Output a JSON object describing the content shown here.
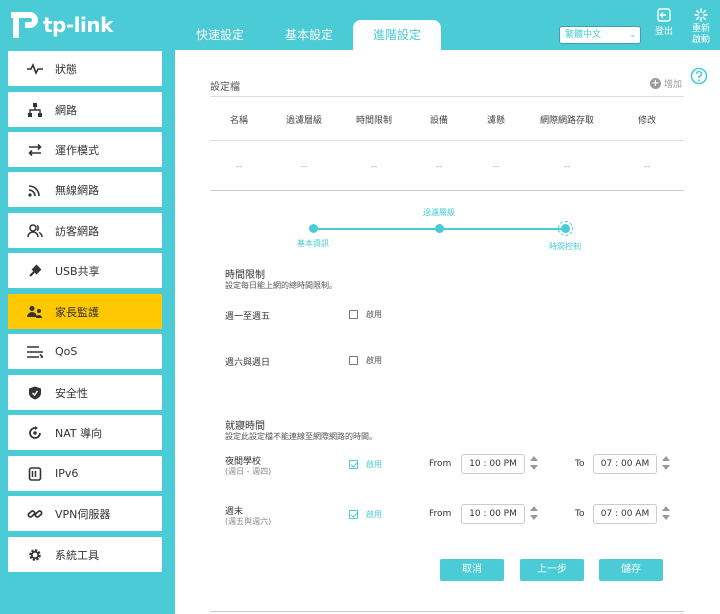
{
  "brand": {
    "logo_text": "tp-link"
  },
  "header": {
    "tabs": [
      {
        "label": "快速設定",
        "active": false
      },
      {
        "label": "基本設定",
        "active": false
      },
      {
        "label": "進階設定",
        "active": true
      }
    ],
    "language": "繁體中文",
    "logout_label": "登出",
    "reboot_label": "重新啟動"
  },
  "sidebar": {
    "items": [
      {
        "label": "狀態",
        "icon": "pulse-icon",
        "active": false
      },
      {
        "label": "網路",
        "icon": "network-icon",
        "active": false
      },
      {
        "label": "運作模式",
        "icon": "mode-icon",
        "active": false
      },
      {
        "label": "無線網路",
        "icon": "wifi-icon",
        "active": false
      },
      {
        "label": "訪客網路",
        "icon": "guest-icon",
        "active": false
      },
      {
        "label": "USB共享",
        "icon": "usb-icon",
        "active": false
      },
      {
        "label": "家長監護",
        "icon": "parental-icon",
        "active": true
      },
      {
        "label": "QoS",
        "icon": "qos-icon",
        "active": false
      },
      {
        "label": "安全性",
        "icon": "shield-icon",
        "active": false
      },
      {
        "label": "NAT 導向",
        "icon": "nat-icon",
        "active": false
      },
      {
        "label": "IPv6",
        "icon": "ipv6-icon",
        "active": false
      },
      {
        "label": "VPN伺服器",
        "icon": "vpn-icon",
        "active": false
      },
      {
        "label": "系統工具",
        "icon": "gear-icon",
        "active": false
      }
    ]
  },
  "profile": {
    "title": "設定檔",
    "add_label": "增加",
    "columns": [
      "名稱",
      "過濾層級",
      "時間限制",
      "設備",
      "濾懸",
      "網際網路存取",
      "修改"
    ],
    "row": [
      "--",
      "--",
      "--",
      "--",
      "--",
      "--",
      "--"
    ]
  },
  "stepper": {
    "steps": [
      "基本資訊",
      "過濾層級",
      "時間控制"
    ]
  },
  "time_limit": {
    "title": "時間限制",
    "desc": "設定每日能上網的總時間限制。",
    "weekday_label": "週一至週五",
    "weekend_label": "週六與週日",
    "enable_label": "啟用"
  },
  "bedtime": {
    "title": "就寢時間",
    "desc": "設定此設定檔不能連線至網際網路的時間。",
    "rows": [
      {
        "label": "夜間學校",
        "sub": "(週日 - 週四)",
        "enable_label": "啟用",
        "from_label": "From",
        "from": "10 : 00  PM",
        "to_label": "To",
        "to": "07 : 00  AM"
      },
      {
        "label": "週末",
        "sub": "(週五與週六)",
        "enable_label": "啟用",
        "from_label": "From",
        "from": "10 : 00  PM",
        "to_label": "To",
        "to": "07 : 00  AM"
      }
    ]
  },
  "buttons": {
    "cancel": "取消",
    "back": "上一步",
    "save": "儲存"
  },
  "colors": {
    "accent": "#4acbd6",
    "active_nav": "#ffc800"
  }
}
